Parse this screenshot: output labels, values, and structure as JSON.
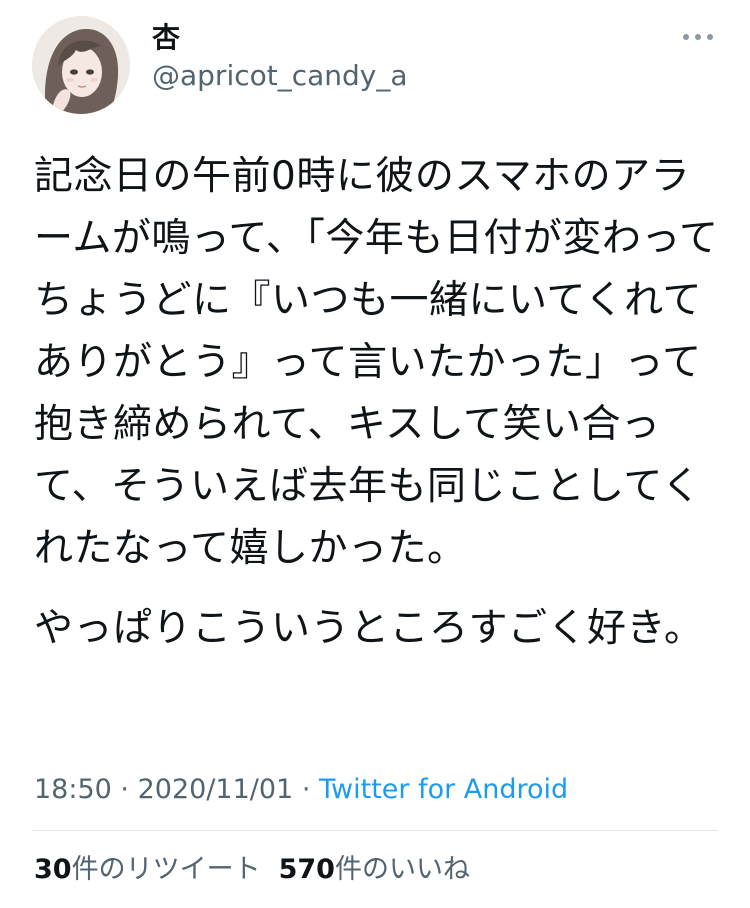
{
  "user": {
    "display_name": "杏",
    "handle": "@apricot_candy_a"
  },
  "tweet": {
    "paragraphs": [
      "記念日の午前0時に彼のスマホのアラームが鳴って、「今年も日付が変わってちょうどに『いつも一緒にいてくれてありがとう』って言いたかった」って抱き締められて、キスして笑い合って、そういえば去年も同じことしてくれたなって嬉しかった。",
      "やっぱりこういうところすごく好き。"
    ],
    "time": "18:50",
    "separator": "·",
    "date": "2020/11/01",
    "source": "Twitter for Android"
  },
  "stats": {
    "retweet_count": "30",
    "retweet_label": "件のリツイート",
    "like_count": "570",
    "like_label": "件のいいね"
  },
  "icons": {
    "more": "more-horizontal-icon",
    "avatar": "avatar-illustration"
  }
}
